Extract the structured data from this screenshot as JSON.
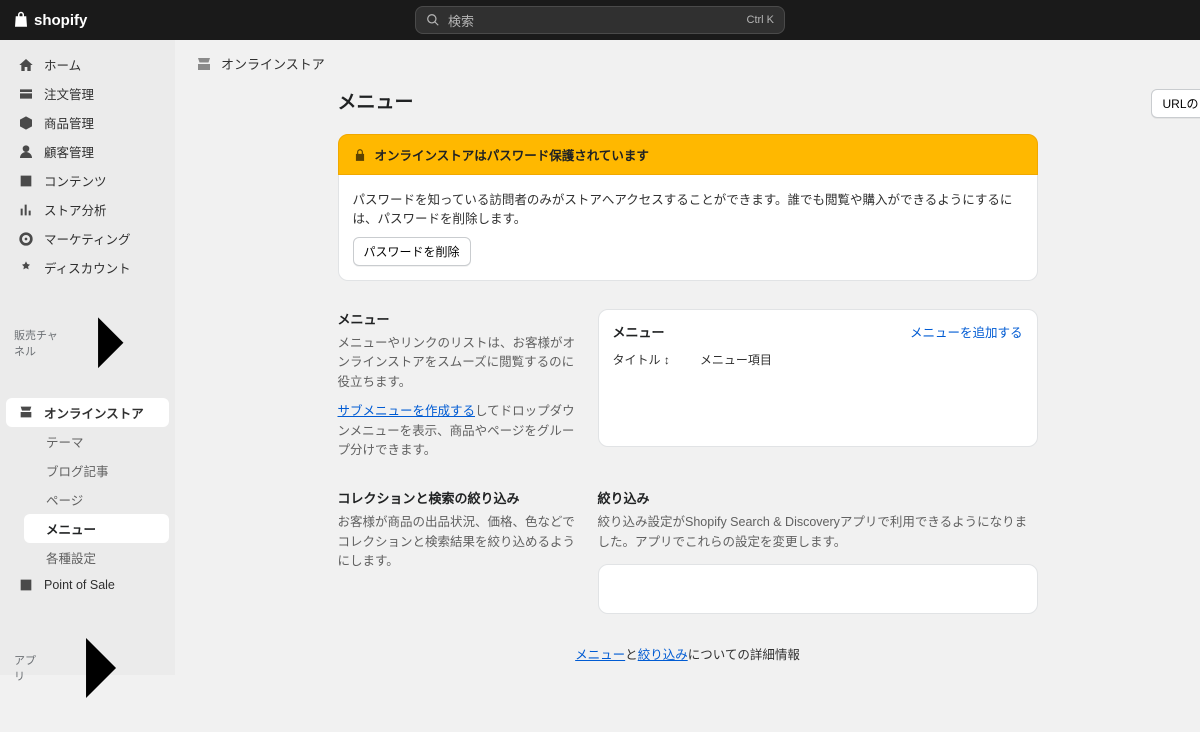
{
  "brand": "shopify",
  "search": {
    "placeholder": "検索",
    "shortcut": "Ctrl K"
  },
  "nav": {
    "home": "ホーム",
    "orders": "注文管理",
    "products": "商品管理",
    "customers": "顧客管理",
    "content": "コンテンツ",
    "analytics": "ストア分析",
    "marketing": "マーケティング",
    "discounts": "ディスカウント"
  },
  "channels_label": "販売チャネル",
  "channels": {
    "online_store": "オンラインストア",
    "sub": {
      "theme": "テーマ",
      "blog": "ブログ記事",
      "pages": "ページ",
      "menu": "メニュー",
      "settings": "各種設定"
    },
    "pos": "Point of Sale"
  },
  "apps_label": "アプリ",
  "breadcrumb": "オンラインストア",
  "page": {
    "title": "メニュー",
    "redirect_btn": "URLのリダイレクトを表示"
  },
  "banner": {
    "title": "オンラインストアはパスワード保護されています",
    "body": "パスワードを知っている訪問者のみがストアへアクセスすることができます。誰でも閲覧や購入ができるようにするには、パスワードを削除します。",
    "btn": "パスワードを削除"
  },
  "menu_section": {
    "title": "メニュー",
    "desc1": "メニューやリンクのリストは、お客様がオンラインストアをスムーズに閲覧するのに役立ちます。",
    "link": "サブメニューを作成する",
    "desc2": "してドロップダウンメニューを表示、商品やページをグループ分けできます。"
  },
  "menu_card": {
    "title": "メニュー",
    "action": "メニューを追加する",
    "col_title": "タイトル",
    "sort_icon": "↕",
    "col_items": "メニュー項目"
  },
  "filter_section": {
    "title": "コレクションと検索の絞り込み",
    "desc": "お客様が商品の出品状況、価格、色などでコレクションと検索結果を絞り込めるようにします。"
  },
  "filter_card": {
    "title": "絞り込み",
    "desc": "絞り込み設定がShopify Search & Discoveryアプリで利用できるようになりました。アプリでこれらの設定を変更します。"
  },
  "footer": {
    "pre": "",
    "link1": "メニュー",
    "mid": "と",
    "link2": "絞り込み",
    "post": "についての詳細情報"
  }
}
